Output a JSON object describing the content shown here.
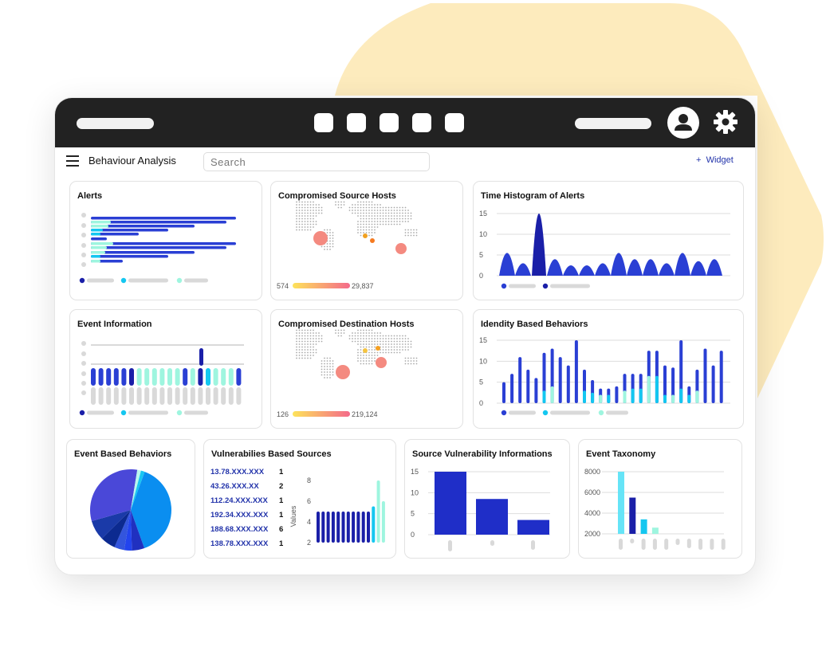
{
  "header": {
    "title": "Behaviour Analysis",
    "search_placeholder": "Search",
    "widget_label": "Widget",
    "widget_plus": "+"
  },
  "colors": {
    "navy": "#1a1fa8",
    "blue": "#2a3fd4",
    "cyan": "#14c7f0",
    "mint": "#9ef5df",
    "grey": "#d9d9d9",
    "salmon": "#f48a80",
    "blob": "#fdebbd",
    "topbar": "#222222"
  },
  "icons": {
    "menu": "hamburger-icon",
    "user": "user-icon",
    "settings": "gear-icon",
    "add": "plus-icon"
  },
  "widgets": {
    "alerts": {
      "title": "Alerts"
    },
    "source_hosts": {
      "title": "Compromised Source Hosts",
      "min": "574",
      "max": "29,837"
    },
    "histogram": {
      "title": "Time Histogram of Alerts",
      "yticks": [
        "15",
        "10",
        "5",
        "0"
      ]
    },
    "event_info": {
      "title": "Event Information"
    },
    "dest_hosts": {
      "title": "Compromised Destination Hosts",
      "min": "126",
      "max": "219,124"
    },
    "identity": {
      "title": "Idendity Based Behaviors",
      "yticks": [
        "15",
        "10",
        "5",
        "0"
      ]
    },
    "event_behaviors": {
      "title": "Event Based Behaviors"
    },
    "vuln_sources": {
      "title": "Vulnerabilies Based Sources",
      "ylabel": "Values",
      "yticks": [
        "8",
        "6",
        "4",
        "2"
      ],
      "rows": [
        {
          "ip": "13.78.XXX.XXX",
          "count": "1"
        },
        {
          "ip": "43.26.XXX.XX",
          "count": "2"
        },
        {
          "ip": "112.24.XXX.XXX",
          "count": "1"
        },
        {
          "ip": "192.34.XXX.XXX",
          "count": "1"
        },
        {
          "ip": "188.68.XXX.XXX",
          "count": "6"
        },
        {
          "ip": "138.78.XXX.XXX",
          "count": "1"
        }
      ]
    },
    "source_vuln": {
      "title": "Source Vulnerability Informations",
      "yticks": [
        "15",
        "10",
        "5",
        "0"
      ]
    },
    "taxonomy": {
      "title": "Event Taxonomy",
      "yticks": [
        "8000",
        "6000",
        "4000",
        "2000"
      ]
    }
  },
  "chart_data": [
    {
      "type": "line",
      "title": "Time Histogram of Alerts",
      "ylim": [
        0,
        15
      ],
      "values": [
        5.5,
        3,
        15,
        4,
        2.5,
        2.5,
        3,
        5.5,
        4,
        4,
        3,
        5.5,
        3.5,
        4
      ]
    },
    {
      "type": "bar",
      "title": "Idendity Based Behaviors",
      "ylim": [
        0,
        15
      ],
      "series": [
        {
          "values": [
            5,
            7,
            11,
            8,
            6,
            12,
            13,
            11,
            9,
            16,
            8,
            5.5,
            3.5,
            3.5,
            4,
            7,
            7,
            7,
            12.5,
            12.5,
            9,
            8.5,
            16,
            4,
            8,
            13,
            9,
            12.5
          ]
        },
        {
          "values": [
            0,
            0,
            0,
            0,
            0,
            3,
            4,
            0,
            0,
            0,
            3,
            2.5,
            2,
            2,
            0,
            3,
            3.5,
            3.5,
            6.5,
            6.5,
            2,
            2,
            3.5,
            2,
            3,
            0,
            0,
            0
          ]
        }
      ]
    },
    {
      "type": "pie",
      "title": "Event Based Behaviors",
      "values": [
        39,
        5,
        3,
        4,
        6,
        8,
        32,
        1.5,
        1.5
      ]
    },
    {
      "type": "bar",
      "title": "Vulnerabilies Based Sources",
      "ylim": [
        2,
        8
      ],
      "values": [
        5,
        5,
        5,
        5,
        5,
        5,
        5,
        5,
        5,
        5,
        5,
        5.5,
        8,
        6
      ]
    },
    {
      "type": "bar",
      "title": "Source Vulnerability Informations",
      "ylim": [
        0,
        15
      ],
      "categories": [
        "",
        "",
        ""
      ],
      "values": [
        15,
        8.5,
        3.5
      ]
    },
    {
      "type": "bar",
      "title": "Event Taxonomy",
      "ylim": [
        2000,
        8000
      ],
      "values": [
        8000,
        5500,
        3400,
        2600,
        0,
        0,
        0,
        0,
        0,
        0
      ]
    }
  ]
}
